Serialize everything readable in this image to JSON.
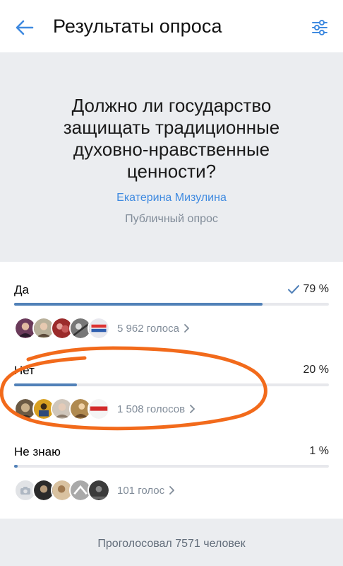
{
  "header": {
    "title": "Результаты опроса",
    "back_icon": "arrow-left-icon",
    "filter_icon": "sliders-icon",
    "accent": "#3f8ae0"
  },
  "poll": {
    "question": "Должно ли государство защищать традиционные духовно-нравственные ценности?",
    "author": "Екатерина Мизулина",
    "type": "Публичный опрос"
  },
  "options": [
    {
      "label": "Да",
      "percent": "79 %",
      "fraction": 0.79,
      "votes": "5 962 голоса",
      "selected": true
    },
    {
      "label": "Нет",
      "percent": "20 %",
      "fraction": 0.2,
      "votes": "1 508 голосов",
      "selected": false
    },
    {
      "label": "Не знаю",
      "percent": "1 %",
      "fraction": 0.01,
      "votes": "101 голос",
      "selected": false
    }
  ],
  "footer": {
    "total": "Проголосовал 7571 человек"
  },
  "colors": {
    "bar": "#5181b8",
    "track": "#e7e8ec",
    "annotation": "#f26a1b",
    "background_block": "#ebedf0"
  }
}
